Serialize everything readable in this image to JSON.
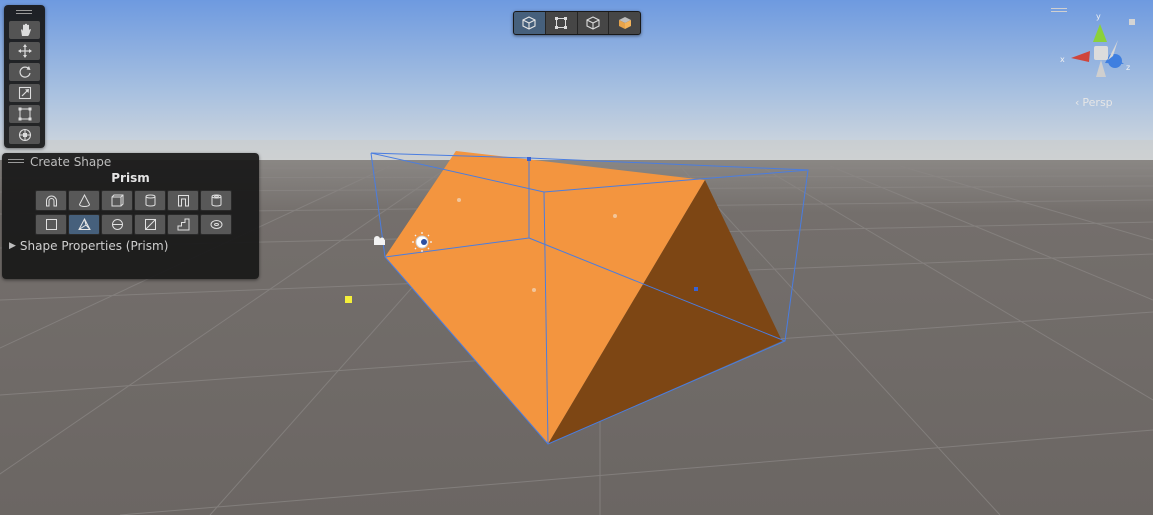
{
  "scene": {
    "view_mode": "persp",
    "persp_label": "Persp",
    "object_color": "#f08a2e",
    "bounds_color": "#4a7de0"
  },
  "toolbar_tools": [
    "hand-tool",
    "move-tool",
    "rotate-tool",
    "scale-tool",
    "rect-tool",
    "transform-tool"
  ],
  "scene_toolbar": {
    "buttons": [
      "select-object",
      "select-vertex",
      "select-edge",
      "select-face"
    ],
    "active_index": 0
  },
  "create_shape": {
    "title": "Create Shape",
    "selected_shape": "Prism",
    "shape_row1": [
      "arch-shape",
      "cone-shape",
      "cube-shape",
      "cylinder-shape",
      "door-shape",
      "pipe-shape"
    ],
    "shape_row2": [
      "plane-shape",
      "prism-shape",
      "sphere-shape",
      "sprite-shape",
      "stairs-shape",
      "torus-shape"
    ],
    "selected_index_row2": 1,
    "properties_label": "Shape Properties (Prism)"
  },
  "gizmo": {
    "axis_labels": [
      "y",
      "x",
      "z"
    ],
    "colors": {
      "x": "#d0453b",
      "y": "#8bd13a",
      "z": "#3f7fe0"
    }
  }
}
